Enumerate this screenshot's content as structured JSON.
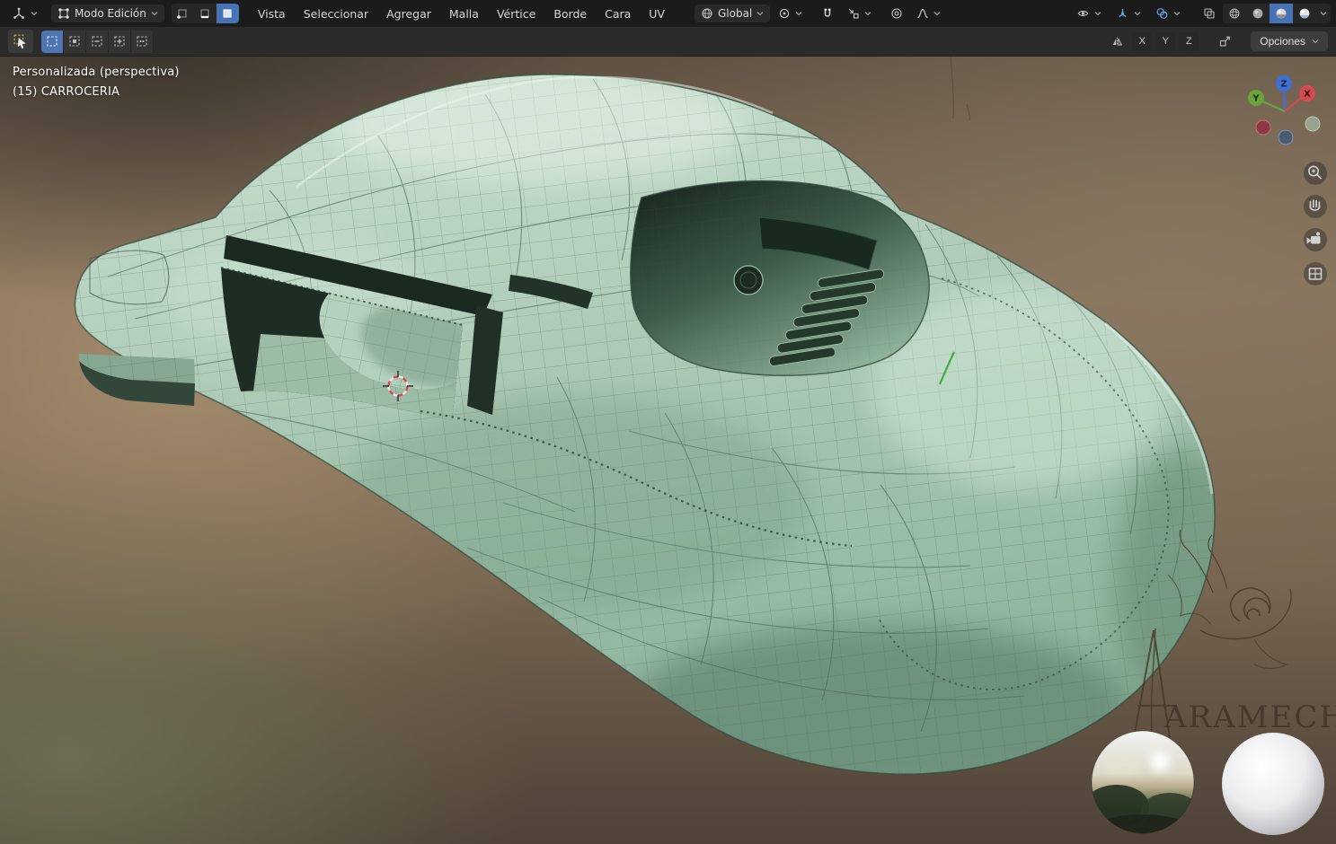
{
  "header": {
    "mode_label": "Modo Edición",
    "menus": [
      "Vista",
      "Seleccionar",
      "Agregar",
      "Malla",
      "Vértice",
      "Borde",
      "Cara",
      "UV"
    ],
    "orientation_label": "Global",
    "active_select_mode": "face",
    "active_shading_mode": "material-preview"
  },
  "tool_settings": {
    "axes": [
      "X",
      "Y",
      "Z"
    ],
    "options_label": "Opciones"
  },
  "viewport": {
    "view_label": "Personalizada (perspectiva)",
    "object_label": "(15) CARROCERIA",
    "gizmo": {
      "x": "X",
      "y": "Y",
      "z": "Z"
    },
    "watermark": "ARAMECHA"
  },
  "colors": {
    "accent_blue": "#4772b3",
    "header_bg": "#1b1b1b",
    "toolbar_bg": "#2b2b2b",
    "body_mint": "#aecbb8",
    "wireframe_green": "#41634f",
    "background_brown": "#7c6a57",
    "axis_x_red": "#d6494f",
    "axis_y_green": "#6aa33c",
    "axis_z_blue": "#3d6fd6"
  },
  "icon_names": [
    "editor-type-icon",
    "edit-mode-icon",
    "vertex-select-icon",
    "edge-select-icon",
    "face-select-icon",
    "global-orientation-icon",
    "pivot-point-icon",
    "snap-magnet-icon",
    "snap-target-icon",
    "proportional-editing-icon",
    "falloff-curve-icon",
    "visibility-eye-icon",
    "gizmos-icon",
    "overlays-icon",
    "xray-toggle-icon",
    "wireframe-shading-icon",
    "solid-shading-icon",
    "material-shading-icon",
    "rendered-shading-icon",
    "chevron-down-icon",
    "tweak-tool-icon",
    "select-box-icon",
    "mirror-icon",
    "transform-snap-icon",
    "zoom-icon",
    "pan-hand-icon",
    "camera-view-icon",
    "grid-view-icon",
    "nav-gizmo",
    "cursor-3d",
    "hdri-preview-sphere",
    "matcap-sphere"
  ]
}
